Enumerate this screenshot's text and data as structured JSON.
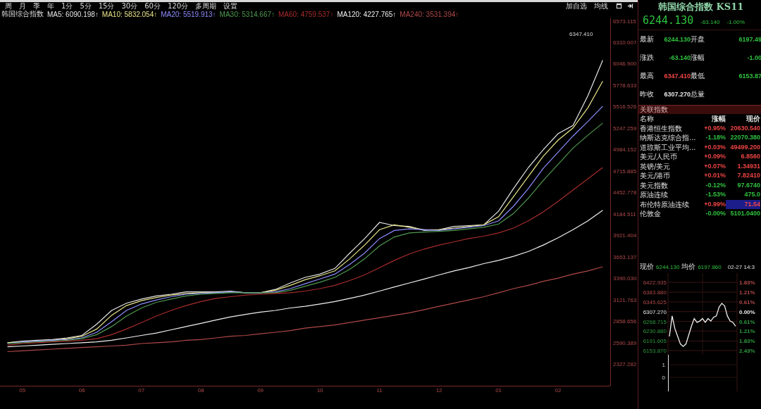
{
  "toolbar": {
    "periods": [
      {
        "label": "周",
        "selected": false
      },
      {
        "label": "月",
        "selected": false
      },
      {
        "label": "季",
        "selected": false
      },
      {
        "label": "年",
        "selected": false
      },
      {
        "label": "1分",
        "selected": false
      },
      {
        "label": "5分",
        "selected": false
      },
      {
        "label": "15分",
        "selected": false
      },
      {
        "label": "30分",
        "selected": false
      },
      {
        "label": "60分",
        "selected": false
      },
      {
        "label": "120分",
        "selected": false
      },
      {
        "label": "多周期",
        "selected": false
      },
      {
        "label": "设置",
        "selected": false
      }
    ],
    "actions": [
      "加自选",
      "均线"
    ]
  },
  "legend": {
    "name": "韩国综合指数",
    "values": [
      ": 6090.198↑",
      ": 5832.054↑",
      ": 5519.913↑",
      ": 5314.667↑",
      ": 4759.537↑",
      ": 4227.765↑",
      ": 3531.394↑"
    ]
  },
  "main_chart": {
    "chart_data": {
      "type": "line",
      "ylim": [
        2057,
        6608
      ],
      "categories": [
        null,
        "05",
        null,
        null,
        null,
        "06",
        null,
        null,
        null,
        "07",
        null,
        null,
        null,
        "08",
        null,
        null,
        null,
        "09",
        null,
        null,
        null,
        "10",
        null,
        null,
        null,
        "11",
        null,
        null,
        null,
        "12",
        null,
        null,
        null,
        "01",
        null,
        null,
        null,
        "02",
        null,
        null,
        null
      ],
      "yticks": [
        {
          "value": 6573.115,
          "label": "6573.115"
        },
        {
          "value": 6310.007,
          "label": "6310.007"
        },
        {
          "value": 6046.9,
          "label": "6046.900"
        },
        {
          "value": 5778.633,
          "label": "5778.633"
        },
        {
          "value": 5516.526,
          "label": "5516.526"
        },
        {
          "value": 5247.259,
          "label": "5247.259"
        },
        {
          "value": 4984.152,
          "label": "4984.152"
        },
        {
          "value": 4715.885,
          "label": "4715.885"
        },
        {
          "value": 4452.778,
          "label": "4452.778"
        },
        {
          "value": 4184.511,
          "label": "4184.511"
        },
        {
          "value": 3921.404,
          "label": "3921.404"
        },
        {
          "value": 3653.137,
          "label": "3653.137"
        },
        {
          "value": 3390.03,
          "label": "3390.030"
        },
        {
          "value": 3121.763,
          "label": "3121.763"
        },
        {
          "value": 2858.656,
          "label": "2858.656"
        },
        {
          "value": 2590.389,
          "label": "2590.389"
        },
        {
          "value": 2327.282,
          "label": "2327.282"
        }
      ],
      "series": [
        {
          "name": "MA5",
          "color": "#e6e6e6",
          "values": [
            2590,
            2610,
            2620,
            2630,
            2650,
            2680,
            2820,
            2990,
            3080,
            3130,
            3170,
            3190,
            3220,
            3220,
            3220,
            3230,
            3210,
            3210,
            3250,
            3330,
            3400,
            3440,
            3510,
            3700,
            3880,
            4080,
            4040,
            4030,
            3980,
            3990,
            4030,
            4040,
            4050,
            4220,
            4500,
            4760,
            4980,
            5180,
            5280,
            5650,
            6090
          ]
        },
        {
          "name": "MA10",
          "color": "#e8e48a",
          "values": [
            2590,
            2600,
            2610,
            2620,
            2640,
            2670,
            2760,
            2930,
            3050,
            3110,
            3150,
            3180,
            3200,
            3210,
            3210,
            3220,
            3210,
            3210,
            3240,
            3300,
            3370,
            3420,
            3480,
            3630,
            3800,
            3990,
            4050,
            4020,
            3990,
            3990,
            4010,
            4030,
            4050,
            4150,
            4400,
            4650,
            4900,
            5100,
            5250,
            5500,
            5830
          ]
        },
        {
          "name": "MA20",
          "color": "#8c8cff",
          "values": [
            2580,
            2600,
            2610,
            2620,
            2630,
            2650,
            2720,
            2850,
            2990,
            3070,
            3120,
            3160,
            3190,
            3200,
            3210,
            3220,
            3210,
            3210,
            3220,
            3260,
            3320,
            3380,
            3440,
            3560,
            3700,
            3880,
            3980,
            4000,
            3990,
            3980,
            4000,
            4020,
            4040,
            4100,
            4280,
            4500,
            4750,
            4950,
            5150,
            5330,
            5520
          ]
        },
        {
          "name": "MA30",
          "color": "#4f9a4f",
          "values": [
            2580,
            2590,
            2600,
            2610,
            2620,
            2640,
            2690,
            2790,
            2920,
            3020,
            3090,
            3130,
            3170,
            3190,
            3200,
            3210,
            3210,
            3210,
            3210,
            3240,
            3290,
            3340,
            3400,
            3500,
            3630,
            3790,
            3900,
            3950,
            3960,
            3970,
            3980,
            4000,
            4020,
            4060,
            4190,
            4380,
            4600,
            4800,
            5000,
            5160,
            5310
          ]
        },
        {
          "name": "MA60",
          "color": "#a82c2c",
          "values": [
            2560,
            2580,
            2590,
            2600,
            2610,
            2620,
            2640,
            2690,
            2760,
            2840,
            2920,
            2990,
            3050,
            3100,
            3140,
            3160,
            3180,
            3190,
            3200,
            3210,
            3230,
            3260,
            3300,
            3360,
            3430,
            3520,
            3610,
            3690,
            3750,
            3800,
            3840,
            3880,
            3910,
            3950,
            4010,
            4100,
            4210,
            4340,
            4480,
            4620,
            4760
          ]
        },
        {
          "name": "MA120",
          "color": "#f0f0f0",
          "values": [
            2540,
            2550,
            2560,
            2570,
            2580,
            2590,
            2600,
            2620,
            2650,
            2680,
            2710,
            2750,
            2790,
            2830,
            2870,
            2910,
            2940,
            2970,
            2990,
            3020,
            3040,
            3070,
            3100,
            3140,
            3180,
            3230,
            3280,
            3330,
            3380,
            3430,
            3480,
            3520,
            3570,
            3610,
            3660,
            3720,
            3800,
            3890,
            3990,
            4100,
            4230
          ]
        },
        {
          "name": "MA240",
          "color": "#b04848",
          "values": [
            2480,
            2490,
            2500,
            2510,
            2520,
            2530,
            2540,
            2550,
            2560,
            2580,
            2590,
            2600,
            2620,
            2630,
            2650,
            2670,
            2680,
            2700,
            2720,
            2740,
            2770,
            2790,
            2810,
            2840,
            2870,
            2900,
            2930,
            2960,
            3000,
            3040,
            3080,
            3120,
            3160,
            3210,
            3260,
            3300,
            3350,
            3390,
            3440,
            3480,
            3530
          ]
        }
      ],
      "annotations": [
        "6347.410"
      ]
    }
  },
  "quote": {
    "title": "韩国综合指数 KS11",
    "price": "6244.130",
    "change": "-63.140",
    "percent": "-1.00%",
    "color": "#2fc23f",
    "rows": [
      {
        "cells": [
          {
            "label": "最新",
            "value": "6244.130",
            "color": "#2fc23f"
          },
          {
            "label": "开盘",
            "value": "6197.49",
            "color": "#2fc23f"
          }
        ]
      },
      {
        "cells": [
          {
            "label": "涨跌",
            "value": "-63.140",
            "color": "#2fc23f"
          },
          {
            "label": "涨幅",
            "value": "-1.00",
            "color": "#2fc23f"
          }
        ]
      },
      {
        "cells": [
          {
            "label": "最高",
            "value": "6347.410",
            "color": "#ee4444"
          },
          {
            "label": "最低",
            "value": "6153.87",
            "color": "#2fc23f"
          }
        ]
      },
      {
        "cells": [
          {
            "label": "昨收",
            "value": "6307.270",
            "color": "#e8e8e8"
          },
          {
            "label": "总量"
          }
        ]
      }
    ]
  },
  "related": {
    "title": "关联指数",
    "columns": [
      "名称",
      "涨幅",
      "现价"
    ],
    "rows": [
      {
        "name": "香港恒生指数",
        "change": "+0.95%",
        "price": "20630.540",
        "color": "#ee4444",
        "selected": false
      },
      {
        "name": "纳斯达克综合指...",
        "change": "-1.18%",
        "price": "22070.380",
        "color": "#2fc23f",
        "selected": false
      },
      {
        "name": "道琼斯工业平均...",
        "change": "+0.03%",
        "price": "49499.200",
        "color": "#ee4444",
        "selected": false
      },
      {
        "name": "美元/人民币",
        "change": "+0.09%",
        "price": "6.8560",
        "color": "#ee4444",
        "selected": false
      },
      {
        "name": "英镑/美元",
        "change": "+0.07%",
        "price": "1.34931",
        "color": "#ee4444",
        "selected": false
      },
      {
        "name": "美元/港币",
        "change": "+0.01%",
        "price": "7.82410",
        "color": "#ee4444",
        "selected": false
      },
      {
        "name": "美元指数",
        "change": "-0.12%",
        "price": "97.6740",
        "color": "#2fc23f",
        "selected": false
      },
      {
        "name": "原油连续",
        "change": "-1.53%",
        "price": "475.0",
        "color": "#2fc23f",
        "selected": false
      },
      {
        "name": "布伦特原油连续",
        "change": "+0.99%",
        "price": "71.54",
        "color": "#ee4444",
        "selected": true
      },
      {
        "name": "伦敦金",
        "change": "-0.00%",
        "price": "5101.0400",
        "color": "#2fc23f",
        "selected": false
      }
    ]
  },
  "intraday": {
    "price": "6244.130",
    "avg_label": "均价",
    "avg": "6197.860",
    "time": "02-27 14:3",
    "percent_labels": [
      {
        "text": "1.83%",
        "color": "#b04a4a"
      },
      {
        "text": "1.21%",
        "color": "#b04a4a"
      },
      {
        "text": "0.61%",
        "color": "#b04a4a"
      },
      {
        "text": "0.00%",
        "color": "#e8e8e8"
      },
      {
        "text": "0.61%",
        "color": "#2f9a3f"
      },
      {
        "text": "1.21%",
        "color": "#2f9a3f"
      },
      {
        "text": "1.83%",
        "color": "#2f9a3f"
      },
      {
        "text": "2.43%",
        "color": "#2f9a3f"
      }
    ],
    "volume_labels": [
      "1",
      "0"
    ],
    "chart_data": {
      "type": "line",
      "ylim": [
        6153.87,
        6422.935
      ],
      "categories": [
        null,
        null,
        null,
        null,
        null,
        null,
        null,
        null,
        null,
        null,
        null,
        null,
        null,
        null,
        null,
        null,
        null,
        null,
        null,
        null,
        null,
        null,
        null,
        null,
        null
      ],
      "yticks": [
        {
          "value": 6422.935,
          "label": "6422.935"
        },
        {
          "value": 6383.88,
          "label": "6383.880"
        },
        {
          "value": 6345.625,
          "label": "6345.625"
        },
        {
          "value": 6307.27,
          "label": "6307.270"
        },
        {
          "value": 6268.715,
          "label": "6268.715"
        },
        {
          "value": 6230.88,
          "label": "6230.880"
        },
        {
          "value": 6191.605,
          "label": "6191.605"
        },
        {
          "value": 6153.87,
          "label": "6153.870"
        }
      ],
      "series": [
        {
          "name": "现价",
          "color": "#f0f0f0",
          "values": [
            6210,
            6290,
            6240,
            6210,
            6180,
            6170,
            6180,
            6215,
            6250,
            6280,
            6265,
            6270,
            6280,
            6265,
            6280,
            6270,
            6285,
            6290,
            6325,
            6340,
            6330,
            6290,
            6270,
            6265,
            6250
          ]
        }
      ],
      "grid": true
    }
  }
}
